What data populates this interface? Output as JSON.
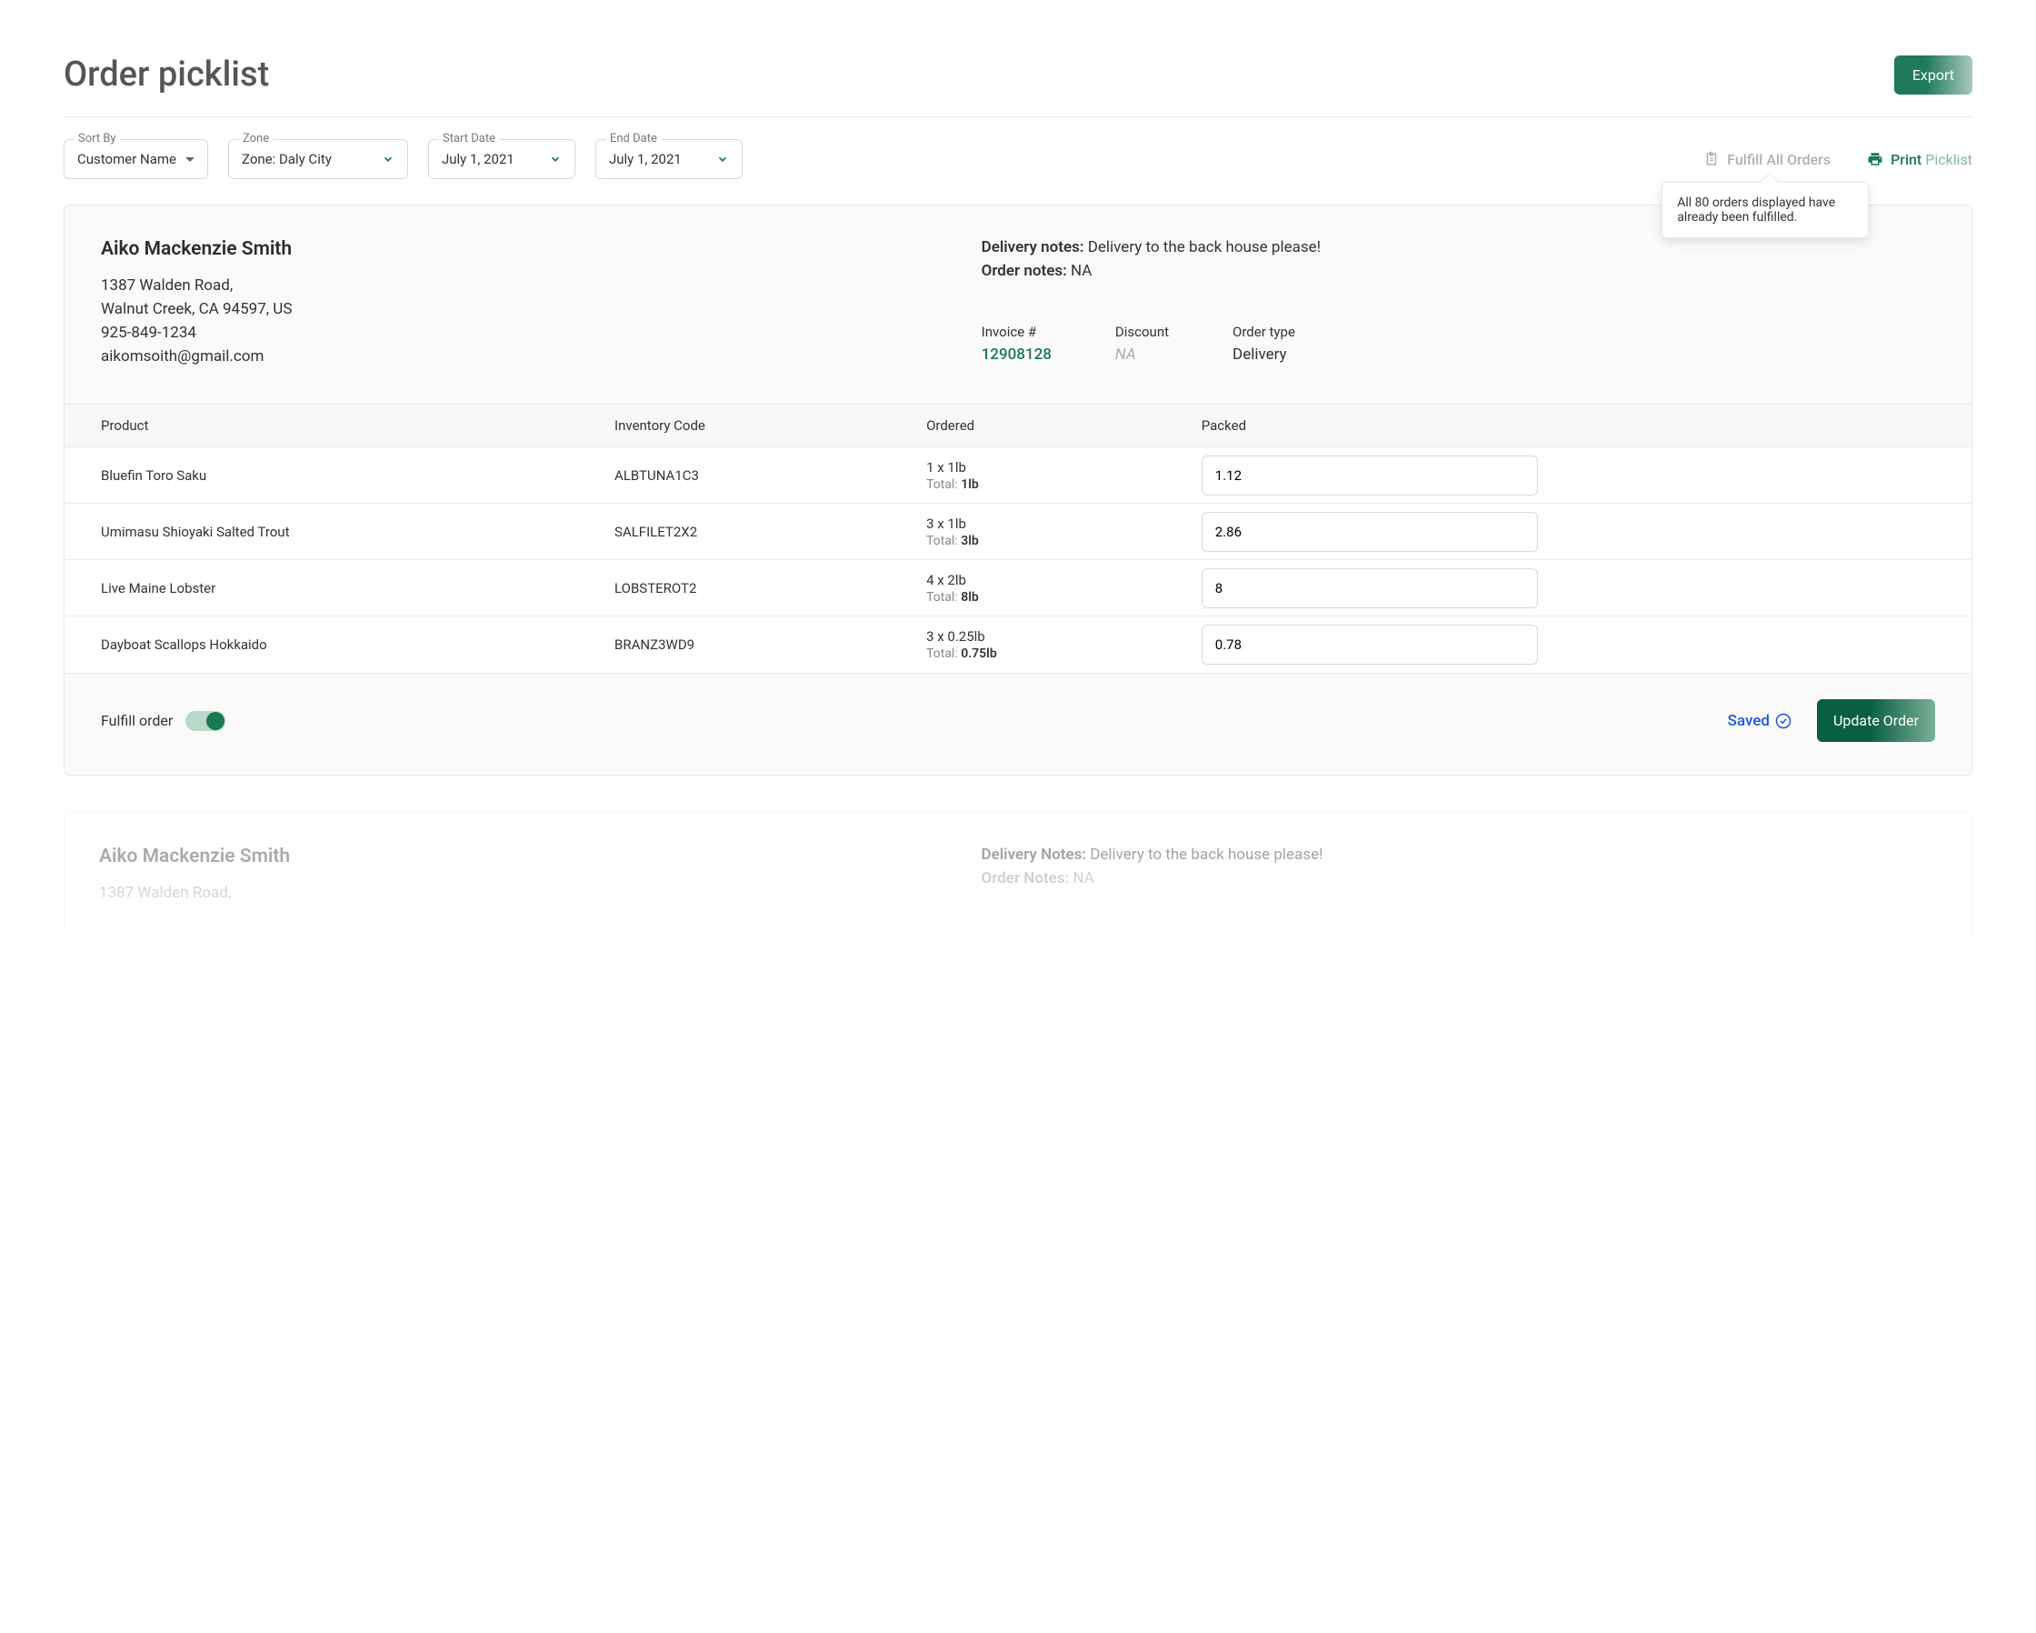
{
  "page": {
    "title": "Order picklist"
  },
  "buttons": {
    "export": "Export",
    "update": "Update Order",
    "saved": "Saved"
  },
  "filters": {
    "sort": {
      "label": "Sort By",
      "value": "Customer Name"
    },
    "zone": {
      "label": "Zone",
      "value": "Zone: Daly City"
    },
    "start": {
      "label": "Start Date",
      "value": "July 1, 2021"
    },
    "end": {
      "label": "End Date",
      "value": "July 1, 2021"
    }
  },
  "actions": {
    "fulfill_all": "Fulfill All Orders",
    "print_prefix": "Print",
    "print_suffix": "Picklist",
    "tooltip": "All 80 orders displayed have already been fulfilled."
  },
  "order": {
    "customer": {
      "name": "Aiko Mackenzie Smith",
      "address1": "1387 Walden Road,",
      "address2": "Walnut Creek, CA 94597, US",
      "phone": "925-849-1234",
      "email": "aikomsoith@gmail.com"
    },
    "delivery_notes_label": "Delivery notes:",
    "delivery_notes": "Delivery to the back house please!",
    "order_notes_label": "Order notes:",
    "order_notes": "NA",
    "invoice_label": "Invoice #",
    "invoice": "12908128",
    "discount_label": "Discount",
    "discount": "NA",
    "type_label": "Order type",
    "type": "Delivery",
    "fulfill_toggle_label": "Fulfill order",
    "fulfill_toggle_on": true
  },
  "table": {
    "headers": {
      "product": "Product",
      "code": "Inventory Code",
      "ordered": "Ordered",
      "packed": "Packed"
    },
    "rows": [
      {
        "product": "Bluefin Toro Saku",
        "code": "ALBTUNA1C3",
        "ordered": "1 x 1lb",
        "total": "1lb",
        "packed": "1.12"
      },
      {
        "product": "Umimasu Shioyaki Salted Trout",
        "code": "SALFILET2X2",
        "ordered": "3 x 1lb",
        "total": "3lb",
        "packed": "2.86"
      },
      {
        "product": "Live Maine Lobster",
        "code": "LOBSTEROT2",
        "ordered": "4 x 2lb",
        "total": "8lb",
        "packed": "8"
      },
      {
        "product": "Dayboat Scallops Hokkaido",
        "code": "BRANZ3WD9",
        "ordered": "3 x 0.25lb",
        "total": "0.75lb",
        "packed": "0.78"
      }
    ]
  },
  "next_order": {
    "name": "Aiko Mackenzie Smith",
    "address_teaser": "1387 Walden Road,",
    "delivery_notes_label": "Delivery Notes:",
    "delivery_notes": "Delivery to the back house please!",
    "order_notes_label": "Order Notes:",
    "order_notes": "NA"
  }
}
